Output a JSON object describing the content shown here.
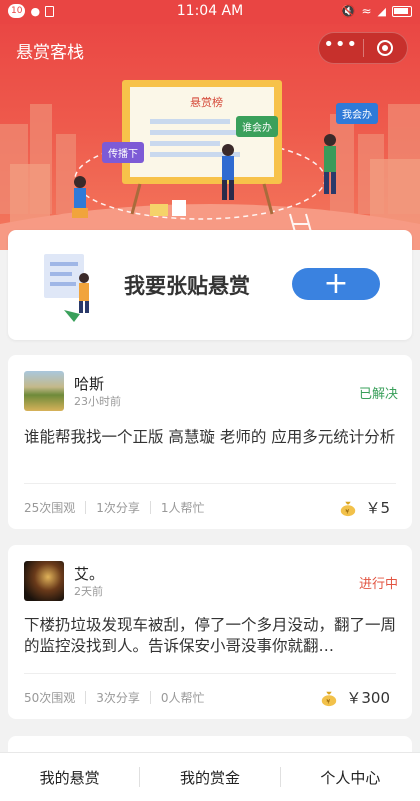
{
  "status_bar": {
    "notification_count": "10",
    "time": "11:04 AM"
  },
  "header": {
    "title": "悬赏客栈",
    "menu_icon": "more-dots-icon",
    "close_icon": "target-circle-icon"
  },
  "banner": {
    "board_title": "悬赏榜",
    "tag_spread": "传播下",
    "tag_who": "谁会办",
    "tag_me": "我会办"
  },
  "post_card": {
    "label": "我要张贴悬赏",
    "button_icon": "plus-icon"
  },
  "tasks": [
    {
      "user": "哈斯",
      "time": "23小时前",
      "status": "已解决",
      "status_color": "#3aa05b",
      "content": "谁能帮我找一个正版 高慧璇 老师的 应用多元统计分析",
      "views": "25次围观",
      "shares": "1次分享",
      "helpers": "1人帮忙",
      "reward": "￥5"
    },
    {
      "user": "艾。",
      "time": "2天前",
      "status": "进行中",
      "status_color": "#e25542",
      "content": "下楼扔垃圾发现车被刮，停了一个多月没动，翻了一周的监控没找到人。告诉保安小哥没事你就翻…",
      "views": "50次围观",
      "shares": "3次分享",
      "helpers": "0人帮忙",
      "reward": "￥300"
    }
  ],
  "tabbar": {
    "tab1": "我的悬赏",
    "tab2": "我的赏金",
    "tab3": "个人中心"
  }
}
